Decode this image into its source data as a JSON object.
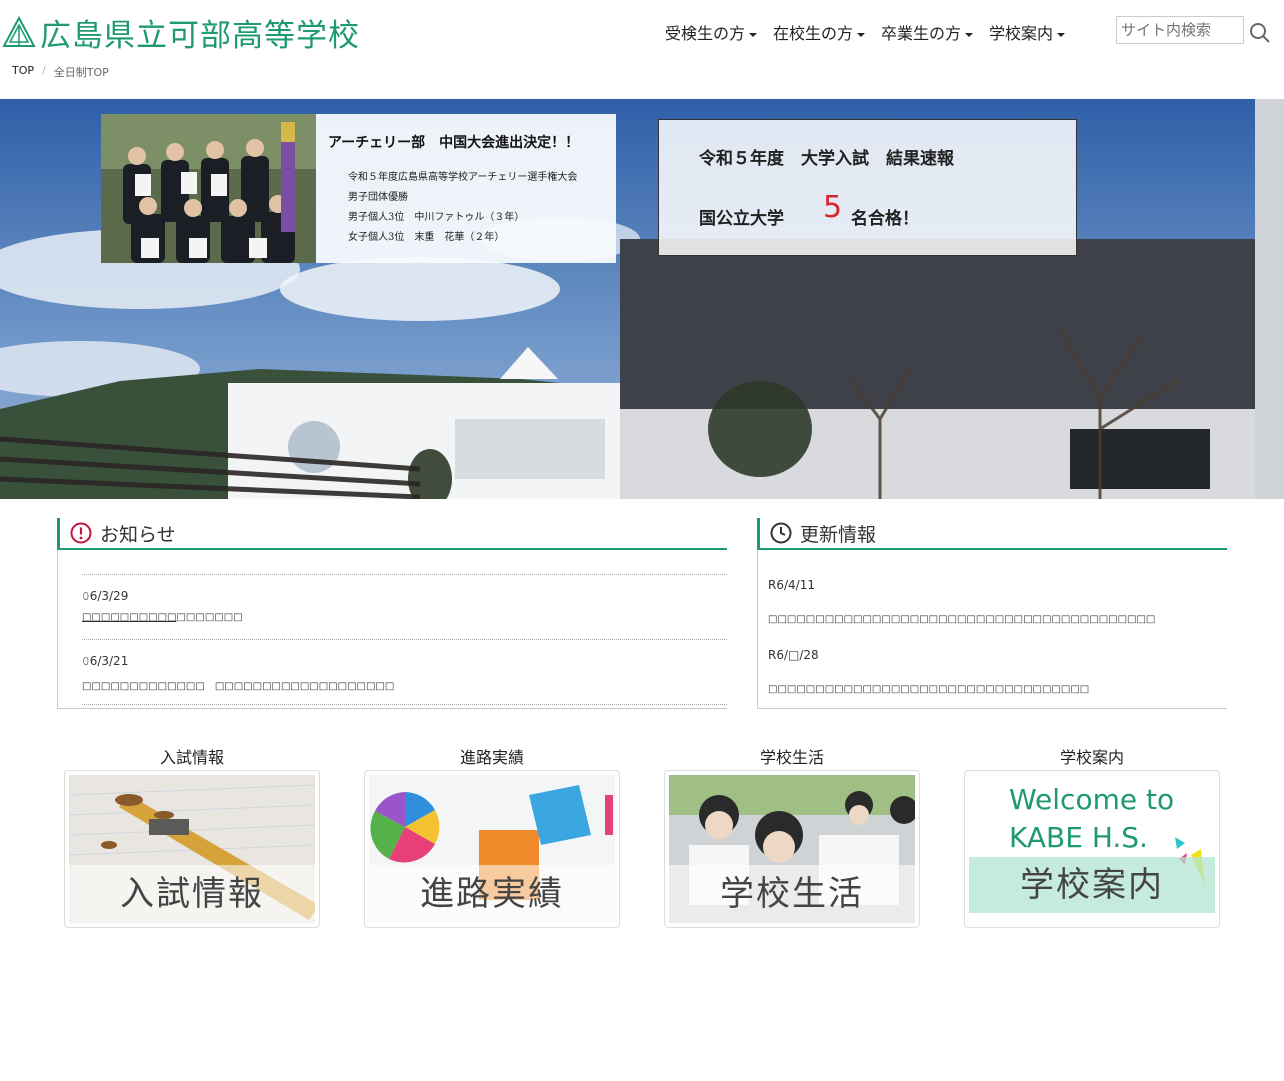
{
  "header": {
    "site_title": "広島県立可部高等学校",
    "nav": [
      {
        "label": "受検生の方"
      },
      {
        "label": "在校生の方"
      },
      {
        "label": "卒業生の方"
      },
      {
        "label": "学校案内"
      }
    ],
    "search_placeholder": "サイト内検索"
  },
  "breadcrumb": {
    "top": "TOP",
    "current": "全日制TOP"
  },
  "hero": {
    "banner1": {
      "title": "アーチェリー部　中国大会進出決定！！",
      "lines": [
        "令和５年度広島県高等学校アーチェリー選手権大会",
        "男子団体優勝",
        "男子個人3位　中川ファトゥル（３年）",
        "女子個人3位　末重　花華（２年）"
      ]
    },
    "banner2": {
      "title": "令和５年度　大学入試　結果速報",
      "prefix": "国公立大学",
      "number": "5",
      "suffix": "名合格！"
    }
  },
  "news": {
    "title": "お知らせ",
    "items": [
      {
        "date": "𝟶6/3/29",
        "link": "□□□□□□□□□□",
        "text": "□□□□□□□"
      },
      {
        "date": "𝟶6/3/21",
        "text": "□□□□□□□□□□□□□　□□□□□□□□□□□□□□□□□□□"
      }
    ]
  },
  "updates": {
    "title": "更新情報",
    "items": [
      {
        "date": "R6/4/11",
        "text": "□□□□□□□□□□□□□□□□□□□□□□□□□□□□□□□□□□□□□□□□□"
      },
      {
        "date": "R6/□/28",
        "text": "□□□□□□□□□□□□□□□□□□□□□□□□□□□□□□□□□□"
      }
    ]
  },
  "tiles": [
    {
      "label": "入試情報",
      "caption": "入試情報"
    },
    {
      "label": "進路実績",
      "caption": "進路実績"
    },
    {
      "label": "学校生活",
      "caption": "学校生活"
    },
    {
      "label": "学校案内",
      "caption": "学校案内",
      "welcome_line1": "Welcome to",
      "welcome_line2": "KABE H.S."
    }
  ],
  "colors": {
    "brand_green": "#1f9a6c",
    "accent_red": "#d8262f",
    "news_icon": "#c0163d"
  }
}
